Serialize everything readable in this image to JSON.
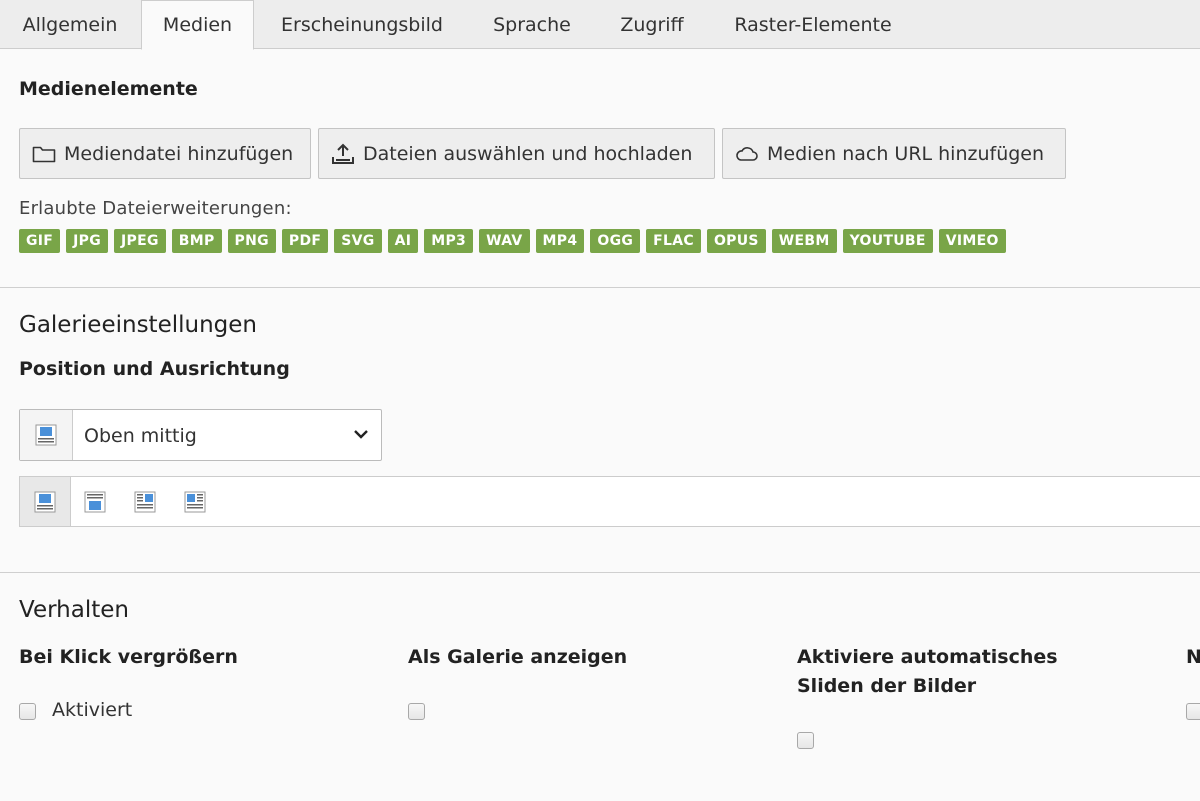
{
  "tabs": [
    "Allgemein",
    "Medien",
    "Erscheinungsbild",
    "Sprache",
    "Zugriff",
    "Raster-Elemente"
  ],
  "active_tab": "Medien",
  "media": {
    "heading": "Medienelemente",
    "buttons": {
      "add_file": "Mediendatei hinzufügen",
      "upload": "Dateien auswählen und hochladen",
      "add_url": "Medien nach URL hinzufügen"
    },
    "allowed_label": "Erlaubte Dateierweiterungen:",
    "extensions": [
      "GIF",
      "JPG",
      "JPEG",
      "BMP",
      "PNG",
      "PDF",
      "SVG",
      "AI",
      "MP3",
      "WAV",
      "MP4",
      "OGG",
      "FLAC",
      "OPUS",
      "WEBM",
      "YOUTUBE",
      "VIMEO"
    ],
    "badge_color": "#79a548"
  },
  "gallery": {
    "heading": "Galerieeinstellungen",
    "position_label": "Position und Ausrichtung",
    "position_value": "Oben mittig"
  },
  "behavior": {
    "heading": "Verhalten",
    "fields": [
      {
        "label": "Bei Klick vergrößern",
        "checkbox_label": "Aktiviert"
      },
      {
        "label": "Als Galerie anzeigen",
        "checkbox_label": ""
      },
      {
        "label": "Aktiviere automatisches Sliden der Bilder",
        "checkbox_label": ""
      },
      {
        "label": "N",
        "checkbox_label": ""
      }
    ]
  }
}
